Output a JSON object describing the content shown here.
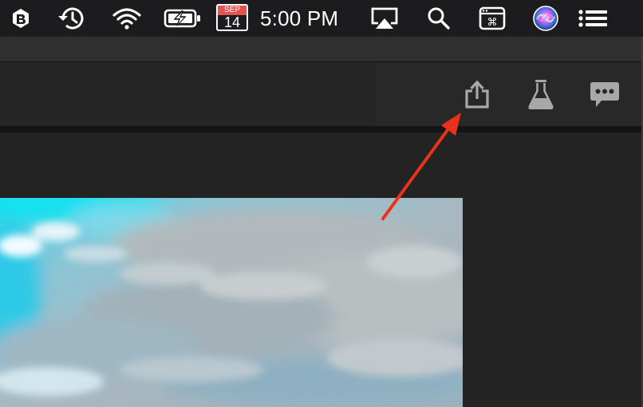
{
  "menubar": {
    "icons": [
      "app-status-icon",
      "time-machine-icon",
      "wifi-icon",
      "battery-charging-icon",
      "airplay-icon",
      "spotlight-search-icon",
      "keyboard-shortcut-icon",
      "siri-icon",
      "notification-center-icon"
    ],
    "calendar": {
      "month": "SEP",
      "day": "14"
    },
    "clock": "5:00 PM"
  },
  "toolbar": {
    "icons": [
      "share-icon",
      "flask-icon",
      "chat-icon"
    ]
  },
  "colors": {
    "menubar_bg": "#1c1c1e",
    "toolbar_bg": "#262626",
    "panel_bg": "#242424",
    "annotation_arrow": "#e8321e",
    "icon_gray": "#a8a8a8"
  }
}
